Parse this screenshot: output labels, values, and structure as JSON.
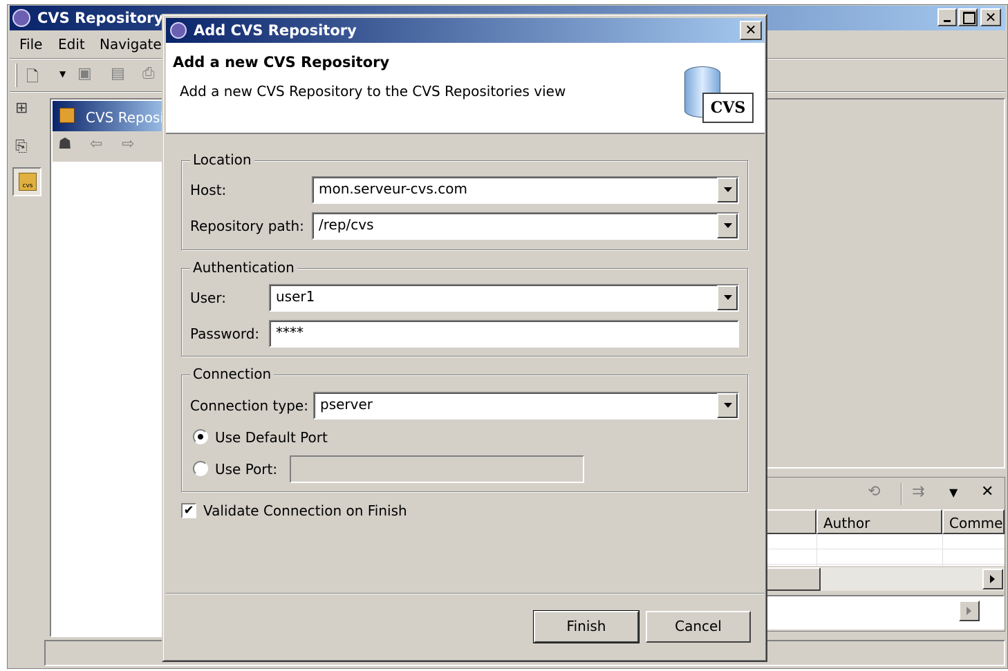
{
  "main_window": {
    "title": "CVS Repository",
    "menu": [
      "File",
      "Edit",
      "Navigate"
    ],
    "view_tab": "CVS Reposi",
    "history_columns": [
      "Author",
      "Commen"
    ]
  },
  "dialog": {
    "title": "Add CVS Repository",
    "header_title": "Add a new CVS Repository",
    "header_desc": "Add a new CVS Repository to the CVS Repositories view",
    "logo_text": "CVS",
    "location": {
      "legend": "Location",
      "host_label": "Host:",
      "host_value": "mon.serveur-cvs.com",
      "path_label": "Repository path:",
      "path_value": "/rep/cvs"
    },
    "authentication": {
      "legend": "Authentication",
      "user_label": "User:",
      "user_value": "user1",
      "password_label": "Password:",
      "password_value": "****"
    },
    "connection": {
      "legend": "Connection",
      "type_label": "Connection type:",
      "type_value": "pserver",
      "default_port_label": "Use Default Port",
      "default_port_selected": true,
      "use_port_label": "Use Port:",
      "use_port_value": ""
    },
    "validate_label": "Validate Connection on Finish",
    "validate_checked": true,
    "finish_label": "Finish",
    "cancel_label": "Cancel"
  },
  "colors": {
    "titlebar_start": "#0a246a",
    "titlebar_end": "#a6caf0",
    "face": "#d4d0c8"
  }
}
